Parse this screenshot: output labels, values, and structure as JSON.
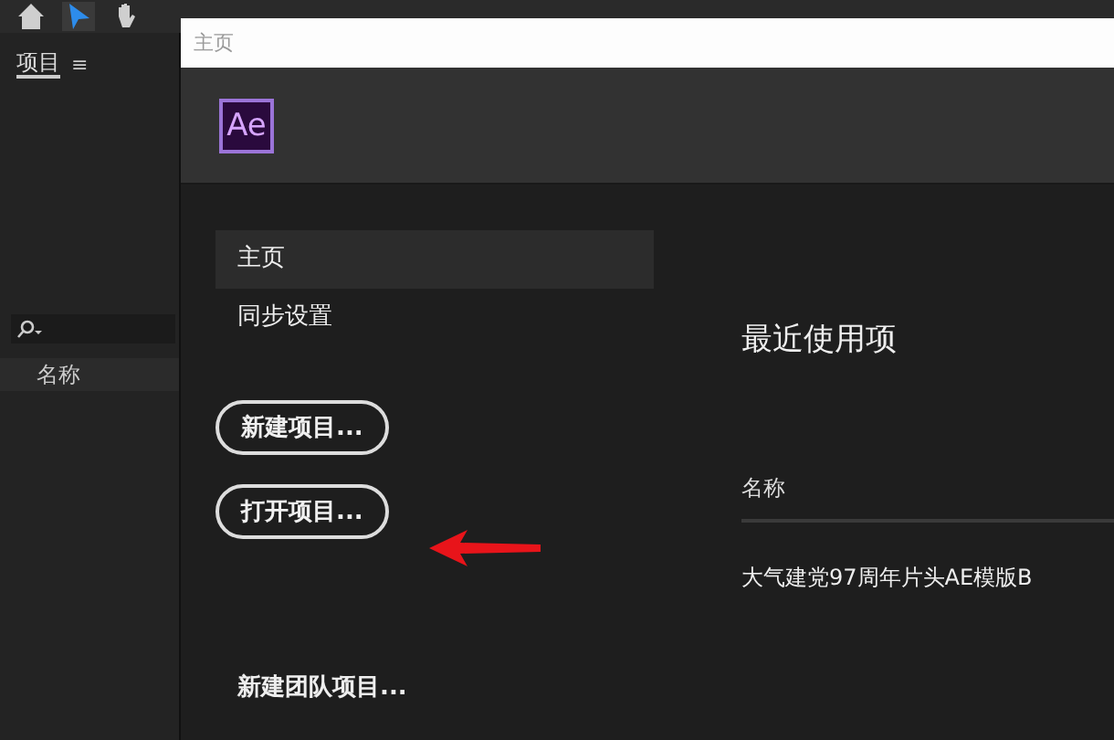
{
  "app": {
    "panel_tab": "项目",
    "panel_menu": "≡",
    "column_header": "名称"
  },
  "dialog": {
    "title": "主页",
    "logo": "Ae",
    "nav": [
      {
        "label": "主页",
        "selected": true
      },
      {
        "label": "同步设置",
        "selected": false
      }
    ],
    "buttons": [
      {
        "label": "新建项目...",
        "kind": "outlined"
      },
      {
        "label": "打开项目...",
        "kind": "outlined"
      }
    ],
    "team_link": "新建团队项目...",
    "recent": {
      "heading": "最近使用项",
      "column": "名称",
      "rows": [
        "大气建党97周年片头AE模版B"
      ]
    }
  }
}
